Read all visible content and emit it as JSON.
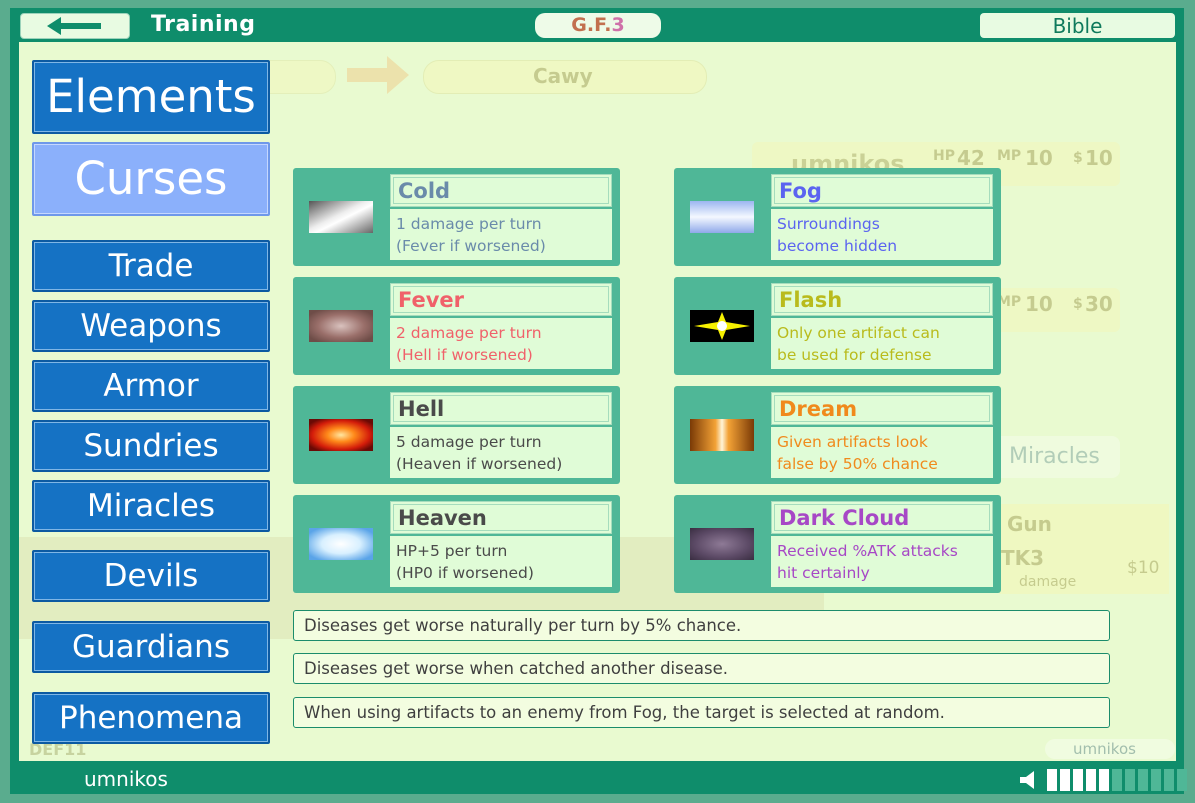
{
  "header": {
    "title": "Training",
    "badge_part1": "G.F.",
    "badge_part2": "3",
    "bible_label": "Bible"
  },
  "sidebar": {
    "items": [
      {
        "label": "Elements"
      },
      {
        "label": "Curses",
        "active": true
      },
      {
        "label": "Trade"
      },
      {
        "label": "Weapons"
      },
      {
        "label": "Armor"
      },
      {
        "label": "Sundries"
      },
      {
        "label": "Miracles"
      },
      {
        "label": "Devils"
      },
      {
        "label": "Guardians"
      },
      {
        "label": "Phenomena"
      }
    ]
  },
  "curses": [
    {
      "name": "Cold",
      "line1": "1 damage per turn",
      "line2": "(Fever if worsened)",
      "color": "#6a8baa"
    },
    {
      "name": "Fog",
      "line1": "Surroundings",
      "line2": "become hidden",
      "color": "#5b64f0"
    },
    {
      "name": "Fever",
      "line1": "2 damage per turn",
      "line2": "(Hell if worsened)",
      "color": "#f0616a"
    },
    {
      "name": "Flash",
      "line1": "Only one artifact can",
      "line2": "be used for defense",
      "color": "#b9bb1c"
    },
    {
      "name": "Hell",
      "line1": "5 damage per turn",
      "line2": "(Heaven if worsened)",
      "color": "#4a4a4a"
    },
    {
      "name": "Dream",
      "line1": "Given artifacts look",
      "line2": "false by 50% chance",
      "color": "#f08a1c"
    },
    {
      "name": "Heaven",
      "line1": "HP+5 per turn",
      "line2": "(HP0 if worsened)",
      "color": "#4a4a4a"
    },
    {
      "name": "Dark Cloud",
      "line1": "Received %ATK attacks",
      "line2": "hit certainly",
      "color": "#a748c6"
    }
  ],
  "notes": [
    "Diseases get worse naturally per turn by 5% chance.",
    "Diseases get worse when catched another disease.",
    "When using artifacts to an enemy from Fog, the target is selected at random."
  ],
  "background_game": {
    "opponent": "Cawy",
    "player_name": "umnikos",
    "hp_label": "HP",
    "hp_value": "42",
    "mp_label": "MP",
    "mp_value": "10",
    "money_symbol": "$",
    "money_value": "10",
    "mp_value_2": "10",
    "money_value_2": "30",
    "miracles_label": "Miracles",
    "gun_label": "Gun",
    "price": "$10",
    "def_label": "DEF11",
    "damage_label": "damage",
    "tk_label": "TK3",
    "footer_name": "umnikos"
  },
  "footer": {
    "username": "umnikos",
    "volume_level": 5,
    "volume_max": 11
  }
}
